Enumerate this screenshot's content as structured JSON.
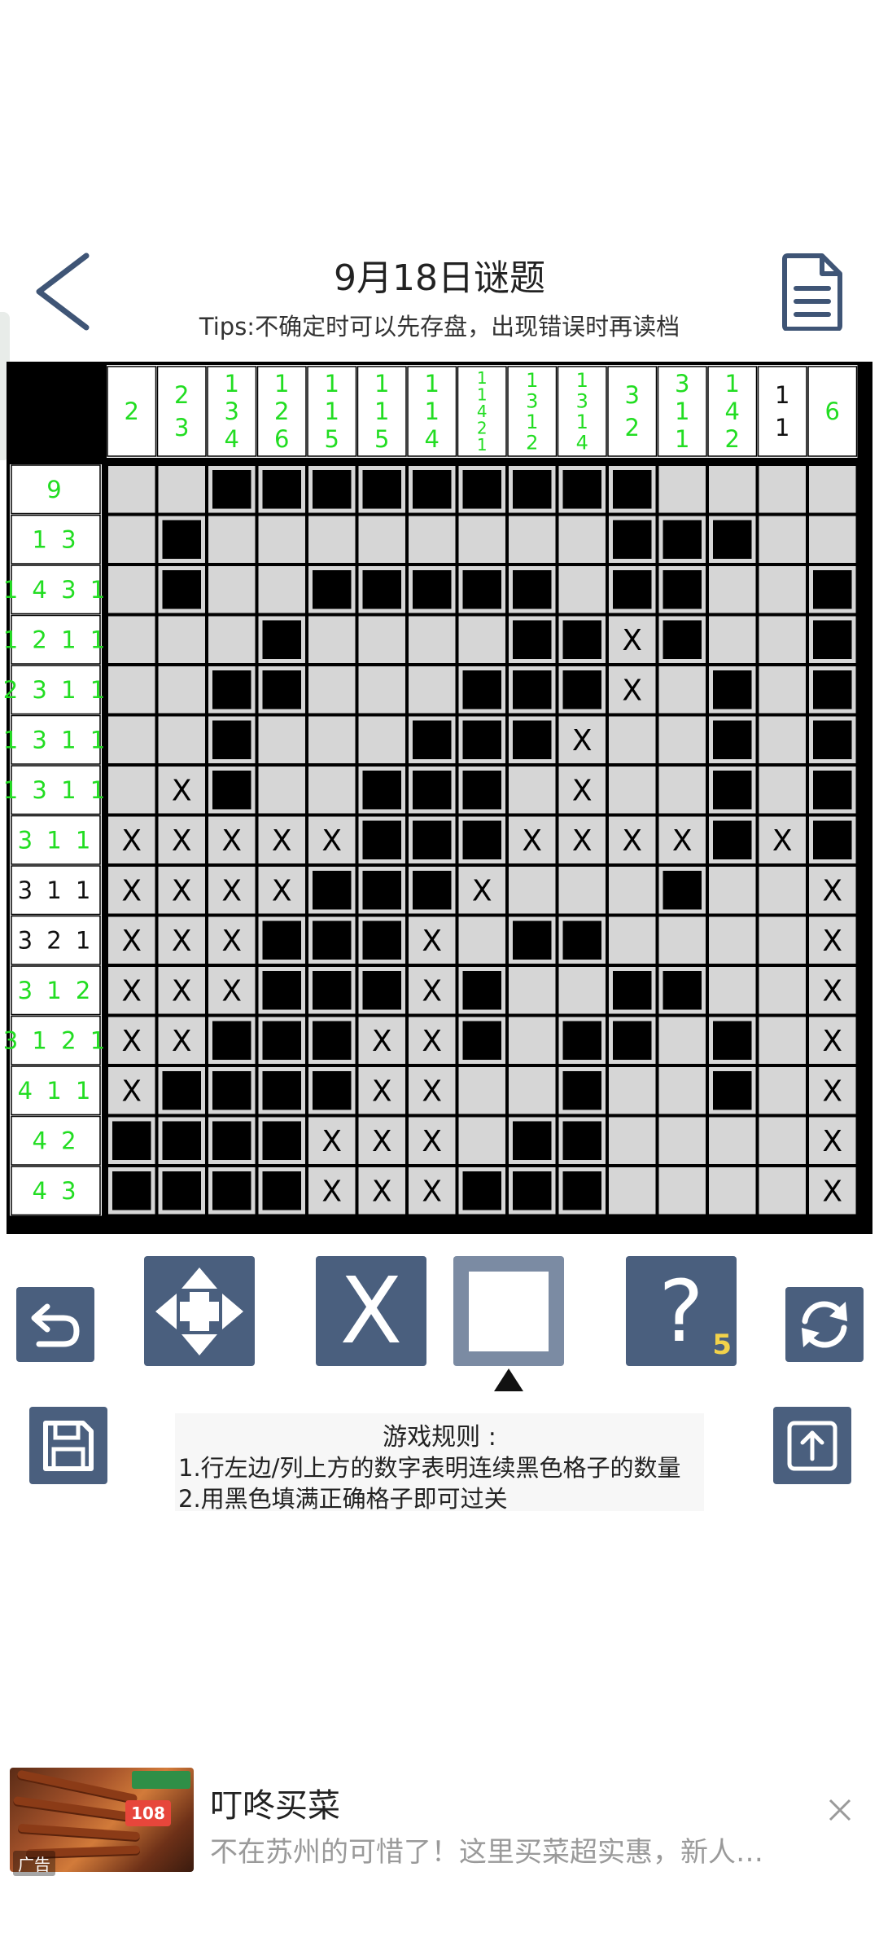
{
  "header": {
    "title": "9月18日谜题",
    "tips": "Tips:不确定时可以先存盘，出现错误时再读档"
  },
  "colors": {
    "clue_green": "#22dd22",
    "clue_black": "#111111",
    "cell_empty": "#d6d6d6",
    "cell_filled": "#000000",
    "button": "#4a5f7e",
    "hint_count": "#f2d24a"
  },
  "icons": {
    "back": "chevron-left-icon",
    "document": "document-icon",
    "undo": "undo-icon",
    "move": "move-arrows-icon",
    "refresh": "refresh-icon",
    "save": "floppy-disk-icon",
    "share": "share-upload-icon",
    "close": "close-icon"
  },
  "puzzle": {
    "col_clues": [
      {
        "nums": [
          "2"
        ],
        "done": true
      },
      {
        "nums": [
          "2",
          "3"
        ],
        "done": true
      },
      {
        "nums": [
          "1",
          "3",
          "4"
        ],
        "done": true
      },
      {
        "nums": [
          "1",
          "2",
          "6"
        ],
        "done": true
      },
      {
        "nums": [
          "1",
          "1",
          "5"
        ],
        "done": true
      },
      {
        "nums": [
          "1",
          "1",
          "5"
        ],
        "done": true
      },
      {
        "nums": [
          "1",
          "1",
          "4"
        ],
        "done": true
      },
      {
        "nums": [
          "1",
          "1",
          "4",
          "2",
          "1"
        ],
        "done": true
      },
      {
        "nums": [
          "1",
          "3",
          "1",
          "2"
        ],
        "done": true
      },
      {
        "nums": [
          "1",
          "3",
          "1",
          "4"
        ],
        "done": true
      },
      {
        "nums": [
          "3",
          "2"
        ],
        "done": true
      },
      {
        "nums": [
          "3",
          "1",
          "1"
        ],
        "done": true
      },
      {
        "nums": [
          "1",
          "4",
          "2"
        ],
        "done": true
      },
      {
        "nums": [
          "1",
          "1"
        ],
        "done": false
      },
      {
        "nums": [
          "6"
        ],
        "done": true
      }
    ],
    "row_clues": [
      {
        "text": "9",
        "done": true
      },
      {
        "text": "1 3",
        "done": true
      },
      {
        "text": "1 4 3 1",
        "done": true
      },
      {
        "text": "1 2 1 1",
        "done": true
      },
      {
        "text": "2 3 1 1",
        "done": true
      },
      {
        "text": "1 3 1 1",
        "done": true
      },
      {
        "text": "1 3 1 1",
        "done": true
      },
      {
        "text": "3 1 1",
        "done": true
      },
      {
        "text": "3 1 1",
        "done": false
      },
      {
        "text": "3 2 1",
        "done": false
      },
      {
        "text": "3 1 2",
        "done": true
      },
      {
        "text": "3 1 2 1",
        "done": true
      },
      {
        "text": "4 1 1",
        "done": true
      },
      {
        "text": "4 2",
        "done": true
      },
      {
        "text": "4 3",
        "done": true
      }
    ],
    "grid": [
      "..#########....",
      ".#........###..",
      ".#..#####.##..#",
      "...#....##X#..#",
      "..##...###X.#.#",
      "..#...###X..#.#",
      ".X#..###.X..#.#",
      "XXXXX###XXXX#X#",
      "XXXX###X...#..X",
      "XXX###X.##....X",
      "XXX###X#..##..X",
      "XX###XX#.##.#.X",
      "X####XX..#..#.X",
      "####XXX.##....X",
      "####XXX###....X"
    ]
  },
  "controls": {
    "hint_symbol": "?",
    "hint_count": "5",
    "x_symbol": "X",
    "selected_tool": "empty"
  },
  "rules": {
    "title": "游戏规则 :",
    "line1": "1.行左边/列上方的数字表明连续黑色格子的数量",
    "line2": "2.用黑色填满正确格子即可过关"
  },
  "ad": {
    "title": "叮咚买菜",
    "description": "不在苏州的可惜了！这里买菜超实惠，新人…",
    "badge": "广告",
    "promo": "108"
  }
}
